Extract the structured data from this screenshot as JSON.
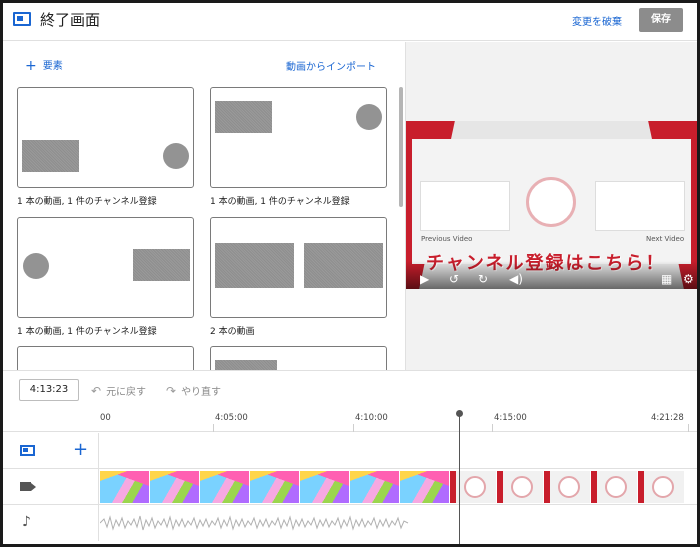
{
  "header": {
    "title": "終了画面",
    "discard_label": "変更を破棄",
    "save_label": "保存"
  },
  "left_panel": {
    "add_element_label": "要素",
    "import_label": "動画からインポート",
    "templates": [
      {
        "label": "1 本の動画, 1 件のチャンネル登録"
      },
      {
        "label": "1 本の動画, 1 件のチャンネル登録"
      },
      {
        "label": "1 本の動画, 1 件のチャンネル登録"
      },
      {
        "label": "2 本の動画"
      }
    ]
  },
  "preview": {
    "left_caption": "Previous Video",
    "right_caption": "Next Video",
    "banner_text": "チャンネル登録はこちら！"
  },
  "toolbar": {
    "timecode": "4:13:23",
    "undo_label": "元に戻す",
    "redo_label": "やり直す"
  },
  "timeline": {
    "ticks": [
      "00",
      "4:05:00",
      "4:10:00",
      "4:15:00",
      "4:21:28"
    ]
  },
  "icons": {
    "end_screen": "end-screen-icon",
    "add": "plus-icon",
    "video_track": "videocam-icon",
    "audio_track": "music-note-icon",
    "undo": "undo-icon",
    "redo": "redo-icon"
  },
  "colors": {
    "accent": "#1a66d2",
    "save_button": "#8c8c8c",
    "brand_red": "#c81e2c"
  }
}
